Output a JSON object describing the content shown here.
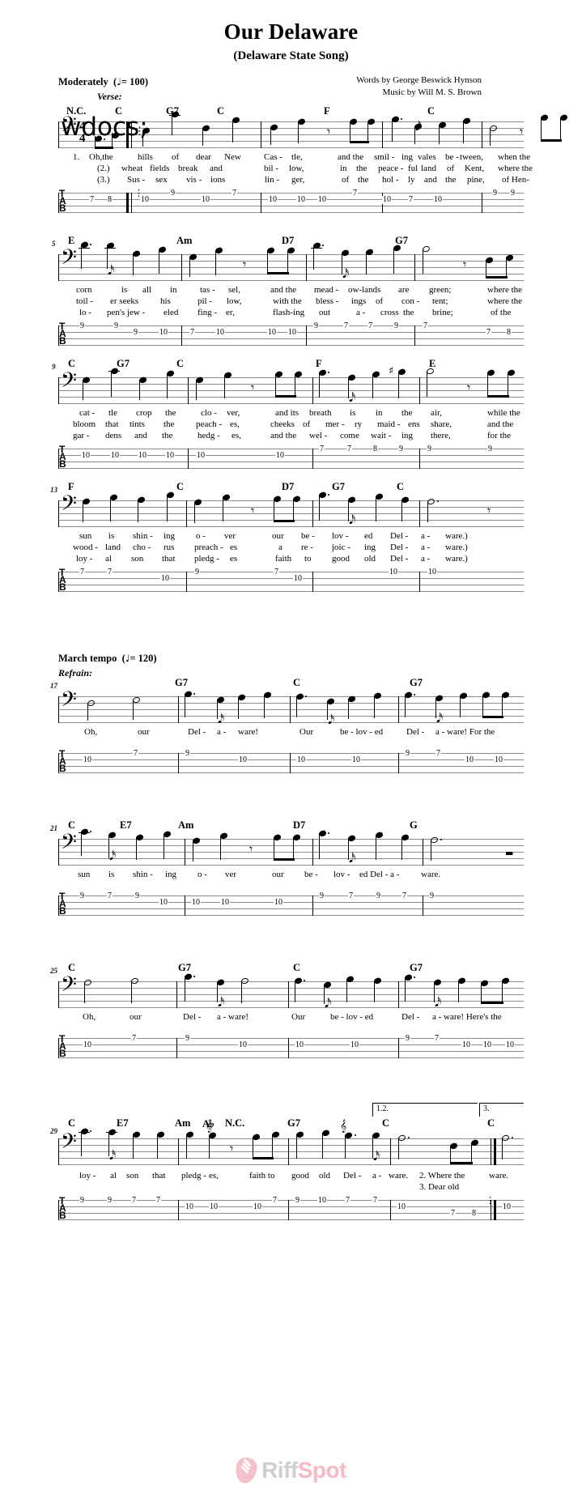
{
  "header": {
    "title": "Our Delaware",
    "subtitle": "(Delaware State Song)",
    "words_credit": "Words by George Beswick Hynson",
    "music_credit": "Music by Will M. S. Brown",
    "tempo_verse": "Moderately  ( = 100)",
    "tempo_verse_text": "Moderately",
    "tempo_verse_value": "= 100",
    "tempo_refrain_text": "March tempo",
    "tempo_refrain_value": "= 120",
    "verse_label": "Verse:",
    "refrain_label": "Refrain:"
  },
  "staff": {
    "clef": "bass-clef",
    "clef_glyph": "𝄢",
    "time_top": "4",
    "time_bottom": "4",
    "tab_letters": [
      "T",
      "A",
      "B"
    ]
  },
  "systems": [
    {
      "measure_number": "",
      "chords": [
        "N.C.",
        "C",
        "G7",
        "C",
        "F",
        "C"
      ],
      "lyrics": [
        [
          "1.",
          "Oh,the",
          "hills",
          "of",
          "dear",
          "New",
          "Cas -",
          "tle,",
          "and the",
          "smil -",
          "ing",
          "vales",
          "be -",
          "tween,",
          "when the"
        ],
        [
          "(2.)",
          "wheat",
          "fields",
          "break",
          "and",
          "bil -",
          "low,",
          "in",
          "the",
          "peace -",
          "ful",
          "land",
          "of",
          "Kent,",
          "where the"
        ],
        [
          "(3.)",
          "Sus -",
          "sex",
          "vis -",
          "ions",
          "lin -",
          "ger,",
          "of",
          "the",
          "hol -",
          "ly",
          "and",
          "the",
          "pine,",
          "of Hen-"
        ]
      ],
      "tab": [
        {
          "string": "A",
          "fret": "7"
        },
        {
          "string": "A",
          "fret": "8"
        },
        {
          "string": "A",
          "fret": "10"
        },
        {
          "string": "T",
          "fret": "9"
        },
        {
          "string": "A",
          "fret": "10"
        },
        {
          "string": "T",
          "fret": "7"
        },
        {
          "string": "A",
          "fret": "10"
        },
        {
          "string": "A",
          "fret": "10"
        },
        {
          "string": "A",
          "fret": "10"
        },
        {
          "string": "T",
          "fret": "7"
        },
        {
          "string": "A",
          "fret": "10"
        },
        {
          "string": "A",
          "fret": "7"
        },
        {
          "string": "A",
          "fret": "10"
        },
        {
          "string": "T",
          "fret": "9"
        },
        {
          "string": "T",
          "fret": "9"
        }
      ]
    },
    {
      "measure_number": "5",
      "chords": [
        "E",
        "Am",
        "D7",
        "G7"
      ],
      "lyrics": [
        [
          "corn",
          "is",
          "all",
          "in",
          "tas -",
          "sel,",
          "and the",
          "mead -",
          "ow-lands",
          "are",
          "green;",
          "where the"
        ],
        [
          "toil -",
          "er seeks",
          "his",
          "pil -",
          "low,",
          "with the",
          "bless -",
          "ings",
          "of",
          "con -",
          "tent;",
          "where the"
        ],
        [
          "lo -",
          "pen's jew -",
          "eled",
          "fing -",
          "er,",
          "flash-ing",
          "out",
          "a -",
          "cross",
          "the",
          "brine;",
          "of the"
        ]
      ],
      "tab": [
        {
          "string": "T",
          "fret": "9"
        },
        {
          "string": "T",
          "fret": "9"
        },
        {
          "string": "A",
          "fret": "9"
        },
        {
          "string": "A",
          "fret": "10"
        },
        {
          "string": "A",
          "fret": "7"
        },
        {
          "string": "A",
          "fret": "10"
        },
        {
          "string": "A",
          "fret": "10"
        },
        {
          "string": "A",
          "fret": "10"
        },
        {
          "string": "T",
          "fret": "9"
        },
        {
          "string": "T",
          "fret": "7"
        },
        {
          "string": "T",
          "fret": "7"
        },
        {
          "string": "T",
          "fret": "9"
        },
        {
          "string": "T",
          "fret": "7"
        },
        {
          "string": "A",
          "fret": "7"
        },
        {
          "string": "A",
          "fret": "8"
        }
      ]
    },
    {
      "measure_number": "9",
      "chords": [
        "C",
        "G7",
        "C",
        "F",
        "E"
      ],
      "lyrics": [
        [
          "cat -",
          "tle",
          "crop",
          "the",
          "clo -",
          "ver,",
          "and its",
          "breath",
          "is",
          "in",
          "the",
          "air,",
          "while the"
        ],
        [
          "bloom",
          "that",
          "tints",
          "the",
          "peach -",
          "es,",
          "cheeks",
          "of",
          "mer -",
          "ry",
          "maid -",
          "ens",
          "share,",
          "and the"
        ],
        [
          "gar -",
          "dens",
          "and",
          "the",
          "hedg -",
          "es,",
          "and the",
          "wel -",
          "come",
          "wait -",
          "ing",
          "there,",
          "for the"
        ]
      ],
      "tab": [
        {
          "string": "A",
          "fret": "10"
        },
        {
          "string": "A",
          "fret": "10"
        },
        {
          "string": "A",
          "fret": "10"
        },
        {
          "string": "A",
          "fret": "10"
        },
        {
          "string": "A",
          "fret": "10"
        },
        {
          "string": "A",
          "fret": "10"
        },
        {
          "string": "T",
          "fret": "7"
        },
        {
          "string": "T",
          "fret": "7"
        },
        {
          "string": "T",
          "fret": "8"
        },
        {
          "string": "T",
          "fret": "9"
        },
        {
          "string": "T",
          "fret": "9"
        },
        {
          "string": "T",
          "fret": "9"
        }
      ]
    },
    {
      "measure_number": "13",
      "chords": [
        "F",
        "C",
        "D7",
        "G7",
        "C"
      ],
      "lyrics": [
        [
          "sun",
          "is",
          "shin -",
          "ing",
          "o -",
          "ver",
          "our",
          "be -",
          "lov -",
          "ed",
          "Del -",
          "a -",
          "ware.)"
        ],
        [
          "wood -",
          "land",
          "cho -",
          "rus",
          "preach -",
          "es",
          "a",
          "re -",
          "joic -",
          "ing",
          "Del -",
          "a -",
          "ware.)"
        ],
        [
          "loy -",
          "al",
          "son",
          "that",
          "pledg -",
          "es",
          "faith",
          "to",
          "good",
          "old",
          "Del -",
          "a -",
          "ware.)"
        ]
      ],
      "tab": [
        {
          "string": "T",
          "fret": "7"
        },
        {
          "string": "T",
          "fret": "7"
        },
        {
          "string": "A",
          "fret": "10"
        },
        {
          "string": "T",
          "fret": "9"
        },
        {
          "string": "T",
          "fret": "7"
        },
        {
          "string": "T",
          "fret": "10"
        },
        {
          "string": "T",
          "fret": "10"
        },
        {
          "string": "T",
          "fret": "10"
        }
      ]
    },
    {
      "measure_number": "17",
      "chords": [
        "G7",
        "C",
        "G7"
      ],
      "lyrics": [
        [
          "Oh,",
          "our",
          "Del -",
          "a -",
          "ware!",
          "Our",
          "be - lov - ed",
          "Del -",
          "a - ware! For the"
        ]
      ],
      "tab": [
        {
          "string": "A",
          "fret": "10"
        },
        {
          "string": "T",
          "fret": "7"
        },
        {
          "string": "T",
          "fret": "9"
        },
        {
          "string": "A",
          "fret": "10"
        },
        {
          "string": "A",
          "fret": "10"
        },
        {
          "string": "A",
          "fret": "10"
        },
        {
          "string": "T",
          "fret": "9"
        },
        {
          "string": "T",
          "fret": "7"
        },
        {
          "string": "A",
          "fret": "10"
        },
        {
          "string": "A",
          "fret": "10"
        }
      ]
    },
    {
      "measure_number": "21",
      "chords": [
        "C",
        "E7",
        "Am",
        "D7",
        "G"
      ],
      "lyrics": [
        [
          "sun",
          "is",
          "shin -",
          "ing",
          "o -",
          "ver",
          "our",
          "be -",
          "lov -",
          "ed Del - a -",
          "ware."
        ]
      ],
      "tab": [
        {
          "string": "T",
          "fret": "9"
        },
        {
          "string": "T",
          "fret": "7"
        },
        {
          "string": "T",
          "fret": "9"
        },
        {
          "string": "A",
          "fret": "10"
        },
        {
          "string": "A",
          "fret": "10"
        },
        {
          "string": "A",
          "fret": "10"
        },
        {
          "string": "A",
          "fret": "10"
        },
        {
          "string": "T",
          "fret": "9"
        },
        {
          "string": "T",
          "fret": "7"
        },
        {
          "string": "T",
          "fret": "9"
        },
        {
          "string": "T",
          "fret": "7"
        },
        {
          "string": "T",
          "fret": "9"
        },
        {
          "string": "T",
          "fret": "7"
        }
      ]
    },
    {
      "measure_number": "25",
      "chords": [
        "C",
        "G7",
        "C",
        "G7"
      ],
      "lyrics": [
        [
          "Oh,",
          "our",
          "Del -",
          "a - ware!",
          "Our",
          "be - lov - ed",
          "Del -",
          "a - ware! Here's the"
        ]
      ],
      "tab": [
        {
          "string": "A",
          "fret": "10"
        },
        {
          "string": "T",
          "fret": "7"
        },
        {
          "string": "T",
          "fret": "9"
        },
        {
          "string": "A",
          "fret": "10"
        },
        {
          "string": "A",
          "fret": "10"
        },
        {
          "string": "A",
          "fret": "10"
        },
        {
          "string": "T",
          "fret": "9"
        },
        {
          "string": "T",
          "fret": "7"
        },
        {
          "string": "A",
          "fret": "10"
        },
        {
          "string": "A",
          "fret": "10"
        },
        {
          "string": "A",
          "fret": "10"
        }
      ]
    },
    {
      "measure_number": "29",
      "chords": [
        "C",
        "E7",
        "Am",
        "A♭",
        "N.C.",
        "G7",
        "C",
        "C"
      ],
      "lyrics": [
        [
          "loy -",
          "al",
          "son",
          "that",
          "pledg -",
          "es,",
          "faith to",
          "good",
          "old",
          "Del -",
          "a -",
          "ware.",
          "ware."
        ]
      ],
      "ending_lyrics": [
        "2.  Where the",
        "3.   Dear  old"
      ],
      "voltas": [
        "1.2.",
        "3."
      ],
      "tab": [
        {
          "string": "T",
          "fret": "9"
        },
        {
          "string": "T",
          "fret": "9"
        },
        {
          "string": "T",
          "fret": "7"
        },
        {
          "string": "T",
          "fret": "7"
        },
        {
          "string": "A",
          "fret": "10"
        },
        {
          "string": "A",
          "fret": "10"
        },
        {
          "string": "A",
          "fret": "10"
        },
        {
          "string": "T",
          "fret": "7"
        },
        {
          "string": "T",
          "fret": "9"
        },
        {
          "string": "T",
          "fret": "10"
        },
        {
          "string": "T",
          "fret": "7"
        },
        {
          "string": "T",
          "fret": "7"
        },
        {
          "string": "A",
          "fret": "10"
        },
        {
          "string": "B",
          "fret": "7"
        },
        {
          "string": "B",
          "fret": "8"
        },
        {
          "string": "A",
          "fret": "10"
        }
      ]
    }
  ],
  "footer": {
    "logo_part1": "Riff",
    "logo_part2": "Spot",
    "logo_icon": "guitar-pick-icon"
  }
}
